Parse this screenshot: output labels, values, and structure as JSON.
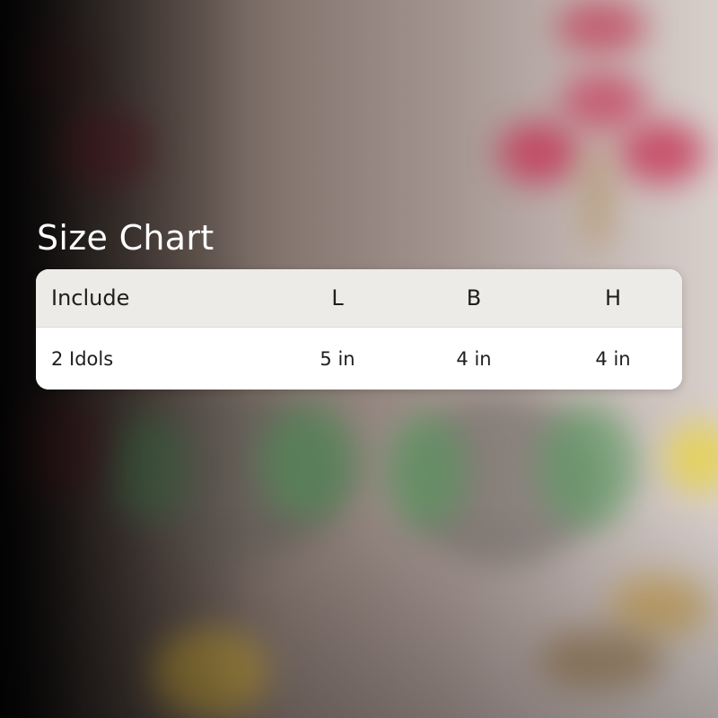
{
  "title": "Size Chart",
  "table": {
    "columns": [
      "Include",
      "L",
      "B",
      "H"
    ],
    "rows": [
      [
        "2 Idols",
        "5 in",
        "4 in",
        "4 in"
      ]
    ]
  },
  "colors": {
    "header_background": "#ecebe7",
    "body_background": "#ffffff",
    "title_text": "#ffffff",
    "table_text": "#1e1e1e"
  }
}
